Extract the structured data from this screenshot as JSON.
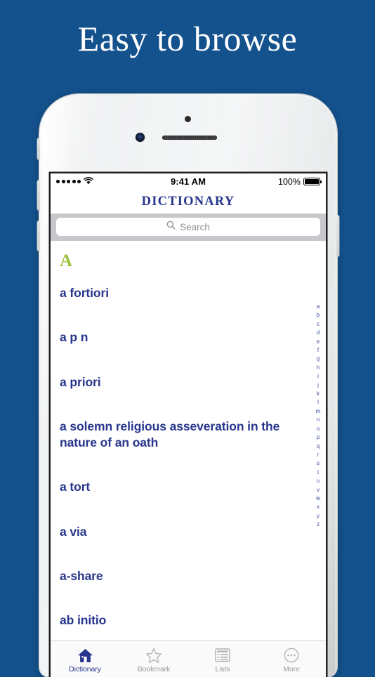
{
  "headline": "Easy to browse",
  "theme": {
    "background_blue": "#14528e",
    "entry_navy": "#27368c",
    "section_letter_green": "#9dc23c",
    "search_bar_gray": "#c8c7cc",
    "placeholder_gray": "#8e8e93",
    "tab_inactive_gray": "#9a9a9f"
  },
  "status_bar": {
    "signal_dots": 5,
    "wifi_icon": "wifi-icon",
    "time": "9:41 AM",
    "battery_percent": "100%",
    "battery_icon": "battery-full-icon"
  },
  "navbar": {
    "title": "DICTIONARY"
  },
  "search": {
    "icon": "search-icon",
    "placeholder": "Search",
    "value": ""
  },
  "list": {
    "section_letter": "A",
    "entries": [
      "a fortiori",
      "a p n",
      "a priori",
      "a solemn religious asseveration in the nature of an oath",
      "a tort",
      "a via",
      "a-share",
      "ab initio"
    ]
  },
  "alphabet_index": [
    "a",
    "b",
    "c",
    "d",
    "e",
    "f",
    "g",
    "h",
    "i",
    "j",
    "k",
    "l",
    "m",
    "n",
    "o",
    "p",
    "q",
    "r",
    "s",
    "t",
    "u",
    "v",
    "w",
    "x",
    "y",
    "z"
  ],
  "tabbar": {
    "tabs": [
      {
        "label": "Dictionary",
        "icon": "home-icon",
        "active": true
      },
      {
        "label": "Bookmark",
        "icon": "star-icon",
        "active": false
      },
      {
        "label": "Lists",
        "icon": "list-icon",
        "active": false
      },
      {
        "label": "More",
        "icon": "ellipsis-circle-icon",
        "active": false
      }
    ]
  }
}
